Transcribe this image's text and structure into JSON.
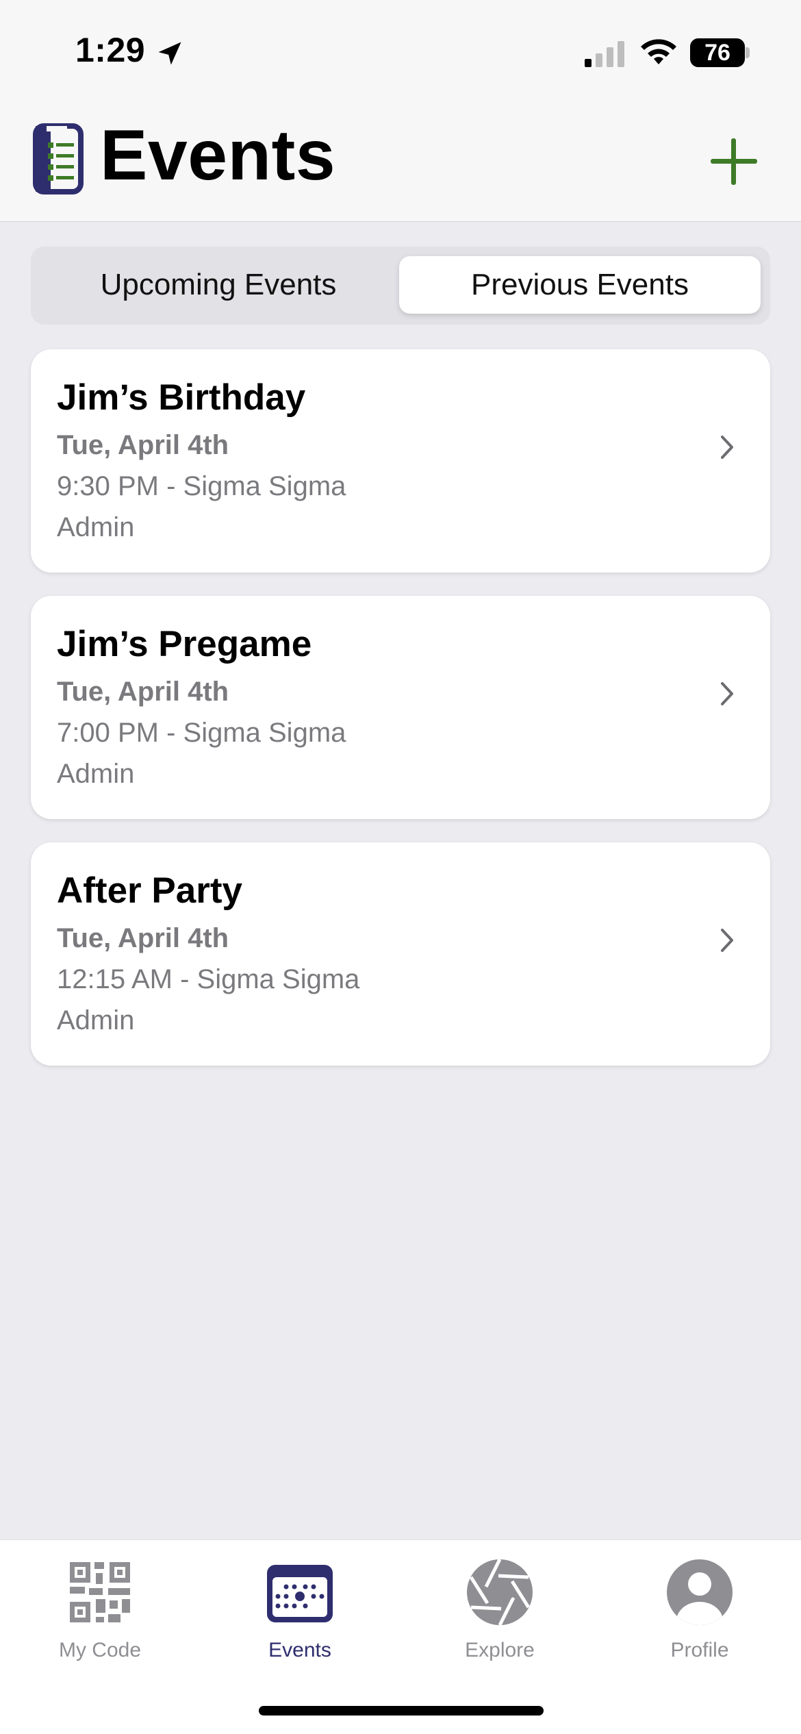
{
  "status_bar": {
    "time": "1:29",
    "battery": "76",
    "icons": [
      "location-arrow-icon",
      "cellular-signal-icon",
      "wifi-icon",
      "battery-icon"
    ]
  },
  "header": {
    "title": "Events",
    "logo_icon": "list-document-icon",
    "add_icon": "plus-icon"
  },
  "segments": {
    "upcoming_label": "Upcoming Events",
    "previous_label": "Previous Events",
    "selected": "Previous Events"
  },
  "events": [
    {
      "title": "Jim’s Birthday",
      "date": "Tue, April 4th",
      "time_location": "9:30 PM - Sigma Sigma",
      "host": "Admin"
    },
    {
      "title": "Jim’s Pregame",
      "date": "Tue, April 4th",
      "time_location": "7:00 PM - Sigma Sigma",
      "host": "Admin"
    },
    {
      "title": "After Party",
      "date": "Tue, April 4th",
      "time_location": "12:15 AM - Sigma Sigma",
      "host": "Admin"
    }
  ],
  "tab_bar": {
    "items": [
      {
        "label": "My Code",
        "icon": "qr-code-icon",
        "active": false
      },
      {
        "label": "Events",
        "icon": "calendar-icon",
        "active": true
      },
      {
        "label": "Explore",
        "icon": "aperture-icon",
        "active": false
      },
      {
        "label": "Profile",
        "icon": "person-circle-icon",
        "active": false
      }
    ]
  },
  "colors": {
    "accent_green": "#3E7B27",
    "brand_navy": "#2E2E6E",
    "inactive_gray": "#8E8E93",
    "background": "#EBEBF0"
  }
}
